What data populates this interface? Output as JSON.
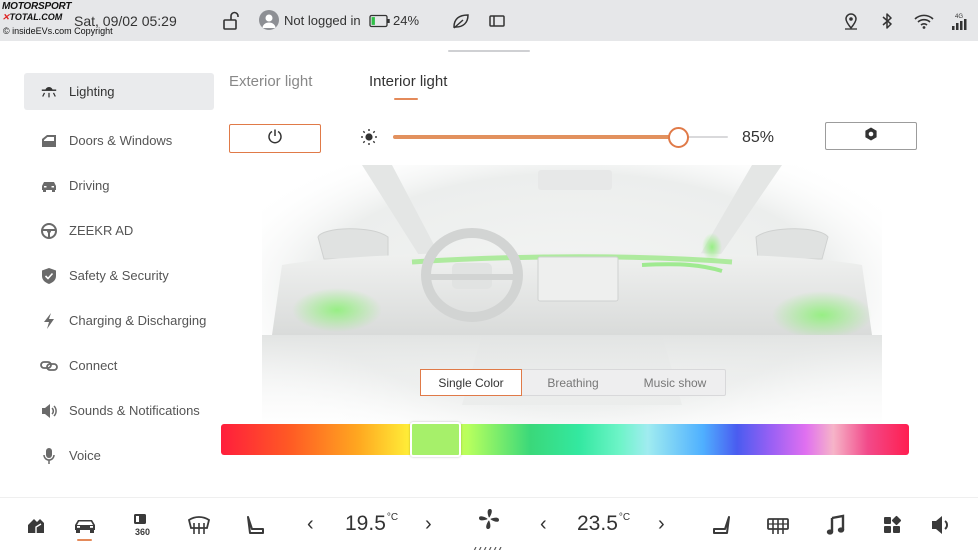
{
  "watermark": {
    "brand_line1": "MOTORSPORT",
    "brand_line2_x": "✕",
    "brand_line2": "TOTAL.COM",
    "copyright": "© insideEVs.com Copyright"
  },
  "status_bar": {
    "datetime": "Sat, 09/02 05:29",
    "user_status": "Not logged in",
    "battery_percent": "24%",
    "battery_level": 0.24,
    "icons": [
      "lock-open-icon",
      "user-avatar-icon",
      "battery-icon",
      "leaf-icon",
      "screen-mirror-icon",
      "location-pin-icon",
      "bluetooth-icon",
      "wifi-icon",
      "signal-4g-icon"
    ],
    "signal_label": "4G"
  },
  "sidebar": {
    "items": [
      {
        "label": "Lighting",
        "icon": "lamp-icon",
        "active": true
      },
      {
        "label": "Doors & Windows",
        "icon": "door-icon",
        "active": false
      },
      {
        "label": "Driving",
        "icon": "car-front-icon",
        "active": false
      },
      {
        "label": "ZEEKR AD",
        "icon": "steering-wheel-icon",
        "active": false
      },
      {
        "label": "Safety & Security",
        "icon": "shield-check-icon",
        "active": false
      },
      {
        "label": "Charging & Discharging",
        "icon": "lightning-icon",
        "active": false
      },
      {
        "label": "Connect",
        "icon": "link-icon",
        "active": false
      },
      {
        "label": "Sounds & Notifications",
        "icon": "speaker-icon",
        "active": false
      },
      {
        "label": "Voice",
        "icon": "microphone-icon",
        "active": false
      }
    ]
  },
  "tabs": [
    {
      "label": "Exterior light",
      "active": false
    },
    {
      "label": "Interior light",
      "active": true
    }
  ],
  "controls": {
    "power_icon": "power-icon",
    "brightness_icon": "sun-icon",
    "brightness_value": 0.85,
    "brightness_label": "85%",
    "settings_icon": "hexagon-settings-icon",
    "accent_color": "#e07a48"
  },
  "modes": [
    {
      "label": "Single Color",
      "active": true
    },
    {
      "label": "Breathing",
      "active": false
    },
    {
      "label": "Music show",
      "active": false
    }
  ],
  "color_picker": {
    "selected_color": "#a6f06a",
    "selected_position": 0.28
  },
  "dock": {
    "left_temp": "19.5",
    "right_temp": "23.5",
    "temp_unit": "°C",
    "prev_arrow": "‹",
    "next_arrow": "›",
    "icons": [
      "home-icon",
      "car-icon",
      "360-camera-icon",
      "rear-defrost-icon",
      "driver-seat-icon",
      "fan-icon",
      "passenger-seat-icon",
      "front-defrost-icon",
      "music-note-icon",
      "apps-grid-icon",
      "volume-icon"
    ],
    "camera_label": "360"
  }
}
